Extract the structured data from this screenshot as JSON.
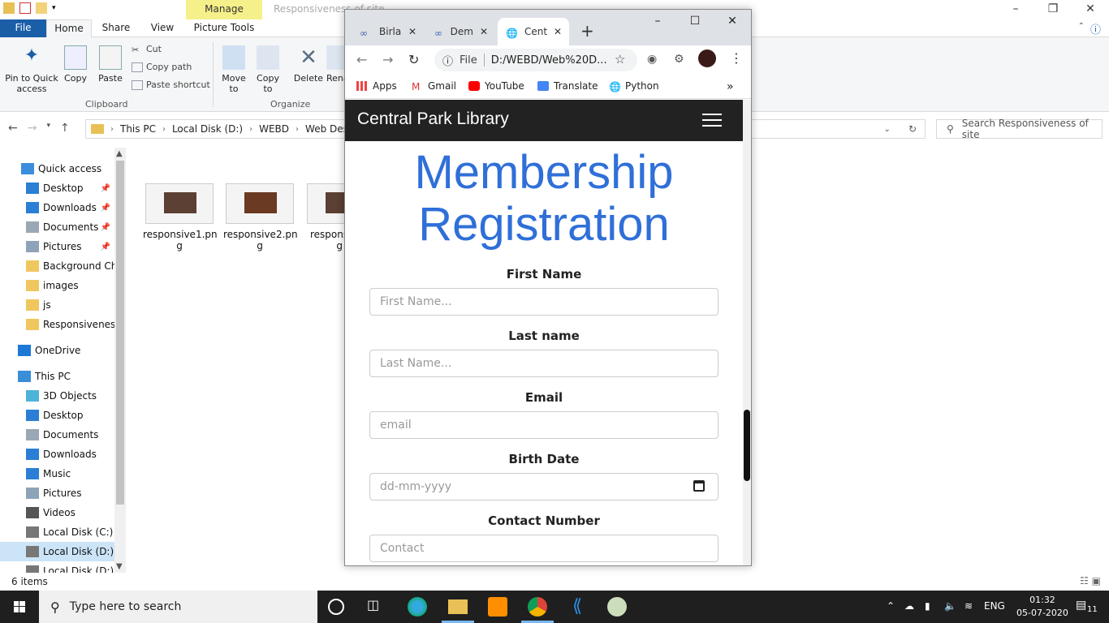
{
  "explorer": {
    "title": "Responsiveness of site",
    "manage_tab": "Manage",
    "picture_tools": "Picture Tools",
    "tabs": [
      "File",
      "Home",
      "Share",
      "View"
    ],
    "ribbon": {
      "pin": "Pin to Quick access",
      "copy": "Copy",
      "paste": "Paste",
      "cut": "Cut",
      "copy_path": "Copy path",
      "paste_shortcut": "Paste shortcut",
      "move_to": "Move to",
      "copy_to": "Copy to",
      "delete": "Delete",
      "rename": "Rena",
      "clipboard_group": "Clipboard",
      "organize_group": "Organize"
    },
    "breadcrumb": [
      "This PC",
      "Local Disk (D:)",
      "WEBD",
      "Web Design"
    ],
    "search_placeholder": "Search Responsiveness of site",
    "nav": [
      {
        "label": "Quick access",
        "icon": "star-icon"
      },
      {
        "label": "Desktop",
        "icon": "desktop-icon",
        "pinned": true
      },
      {
        "label": "Downloads",
        "icon": "download-icon",
        "pinned": true
      },
      {
        "label": "Documents",
        "icon": "documents-icon",
        "pinned": true
      },
      {
        "label": "Pictures",
        "icon": "pictures-icon",
        "pinned": true
      },
      {
        "label": "Background Cha",
        "icon": "folder-icon"
      },
      {
        "label": "images",
        "icon": "folder-icon"
      },
      {
        "label": "js",
        "icon": "folder-icon"
      },
      {
        "label": "Responsiveness",
        "icon": "folder-icon"
      },
      {
        "label": "OneDrive",
        "icon": "cloud-icon"
      },
      {
        "label": "This PC",
        "icon": "computer-icon"
      },
      {
        "label": "3D Objects",
        "icon": "cube-icon"
      },
      {
        "label": "Desktop",
        "icon": "desktop-icon"
      },
      {
        "label": "Documents",
        "icon": "documents-icon"
      },
      {
        "label": "Downloads",
        "icon": "download-icon"
      },
      {
        "label": "Music",
        "icon": "music-icon"
      },
      {
        "label": "Pictures",
        "icon": "pictures-icon"
      },
      {
        "label": "Videos",
        "icon": "video-icon"
      },
      {
        "label": "Local Disk (C:)",
        "icon": "drive-icon"
      },
      {
        "label": "Local Disk (D:)",
        "icon": "drive-icon",
        "selected": true
      },
      {
        "label": "Local Disk (D:) (E",
        "icon": "drive-icon"
      }
    ],
    "files": [
      {
        "name1": "responsive1.pn",
        "name2": "g"
      },
      {
        "name1": "responsive2.pn",
        "name2": "g"
      },
      {
        "name1": "responsi",
        "name2": "g"
      }
    ],
    "status": "6 items"
  },
  "chrome": {
    "tabs": [
      {
        "label": "Birla",
        "icon": "link-icon"
      },
      {
        "label": "Dem",
        "icon": "link-icon"
      },
      {
        "label": "Cent",
        "icon": "globe-icon"
      }
    ],
    "new_tab": "+",
    "url_prefix": "File",
    "url": "D:/WEBD/Web%20D...",
    "bookmarks": [
      "Apps",
      "Gmail",
      "YouTube",
      "Translate",
      "Python"
    ],
    "more_bookmarks": "»"
  },
  "site": {
    "brand": "Central Park Library",
    "heading_line1": "Membership",
    "heading_line2": "Registration",
    "fields": [
      {
        "label": "First Name",
        "placeholder": "First Name..."
      },
      {
        "label": "Last name",
        "placeholder": "Last Name..."
      },
      {
        "label": "Email",
        "placeholder": "email"
      },
      {
        "label": "Birth Date",
        "placeholder": "dd-mm-yyyy"
      },
      {
        "label": "Contact Number",
        "placeholder": "Contact"
      }
    ]
  },
  "taskbar": {
    "search_placeholder": "Type here to search",
    "language": "ENG",
    "time": "01:32",
    "date": "05-07-2020",
    "notifications": "11"
  },
  "colors": {
    "heading_blue": "#2f6fd8",
    "navbar_dark": "#222222",
    "file_tab_blue": "#1a5ea8",
    "manage_yellow": "#f6f08a"
  }
}
